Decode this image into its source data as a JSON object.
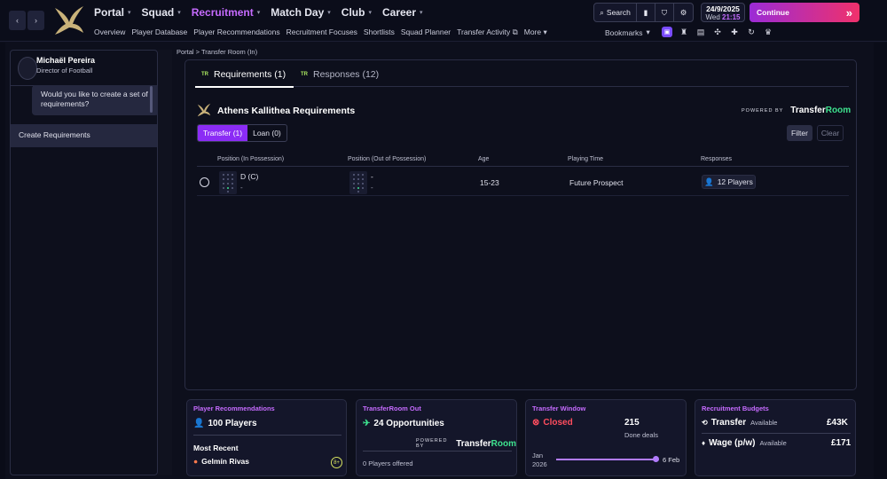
{
  "nav": {
    "back": "‹",
    "forward": "›",
    "main": [
      {
        "label": "Portal",
        "active": false
      },
      {
        "label": "Squad",
        "active": false
      },
      {
        "label": "Recruitment",
        "active": true
      },
      {
        "label": "Match Day",
        "active": false
      },
      {
        "label": "Club",
        "active": false
      },
      {
        "label": "Career",
        "active": false
      }
    ],
    "sub": [
      "Overview",
      "Player Database",
      "Player Recommendations",
      "Recruitment Focuses",
      "Shortlists",
      "Squad Planner",
      "Transfer Activity",
      "More"
    ]
  },
  "topright": {
    "search_label": "Search",
    "date": "24/9/2025",
    "day": "Wed",
    "time": "21:15",
    "continue_label": "Continue",
    "continue_arrows": "»",
    "bookmarks_label": "Bookmarks"
  },
  "sidebar": {
    "name": "Michaël Pereira",
    "role": "Director of Football",
    "message": "Would you like to create a set of requirements?",
    "action": "Create Requirements"
  },
  "breadcrumb": "Portal > Transfer Room (In)",
  "tabs": {
    "requirements": "Requirements (1)",
    "responses": "Responses (12)",
    "tab_icon": "TR"
  },
  "panel": {
    "title": "Athens Kallithea Requirements",
    "powered_by": "POWERED BY",
    "brand_a": "Transfer",
    "brand_b": "Room",
    "toggle_transfer": "Transfer (1)",
    "toggle_loan": "Loan (0)",
    "filter": "Filter",
    "clear": "Clear"
  },
  "table": {
    "headers": [
      "Position (In Possession)",
      "Position (Out of Possession)",
      "Age",
      "Playing Time",
      "Responses"
    ],
    "row": {
      "pos_in": "D (C)",
      "pos_in_sub": "-",
      "pos_out": "-",
      "pos_out_sub": "-",
      "age": "15-23",
      "playing_time": "Future Prospect",
      "responses": "12 Players"
    }
  },
  "cards": {
    "recommendations": {
      "title": "Player Recommendations",
      "count": "100 Players",
      "recent_label": "Most Recent",
      "recent_name": "Gelmín Rivas",
      "badge": "8+"
    },
    "transferroom_out": {
      "title": "TransferRoom Out",
      "count": "24 Opportunities",
      "offered": "0 Players offered"
    },
    "window": {
      "title": "Transfer Window",
      "status": "Closed",
      "deals_value": "215",
      "deals_label": "Done deals",
      "start_month": "Jan",
      "start_year": "2026",
      "end": "6 Feb",
      "progress": 0.97
    },
    "budgets": {
      "title": "Recruitment Budgets",
      "transfer_label": "Transfer",
      "transfer_state": "Available",
      "transfer_value": "£43K",
      "wage_label": "Wage (p/w)",
      "wage_state": "Available",
      "wage_value": "£171"
    }
  },
  "colors": {
    "accent": "#c66bff",
    "toggle_on": "#8b2cf5",
    "brand_green": "#3ee38f",
    "closed_red": "#ff4d5e"
  }
}
